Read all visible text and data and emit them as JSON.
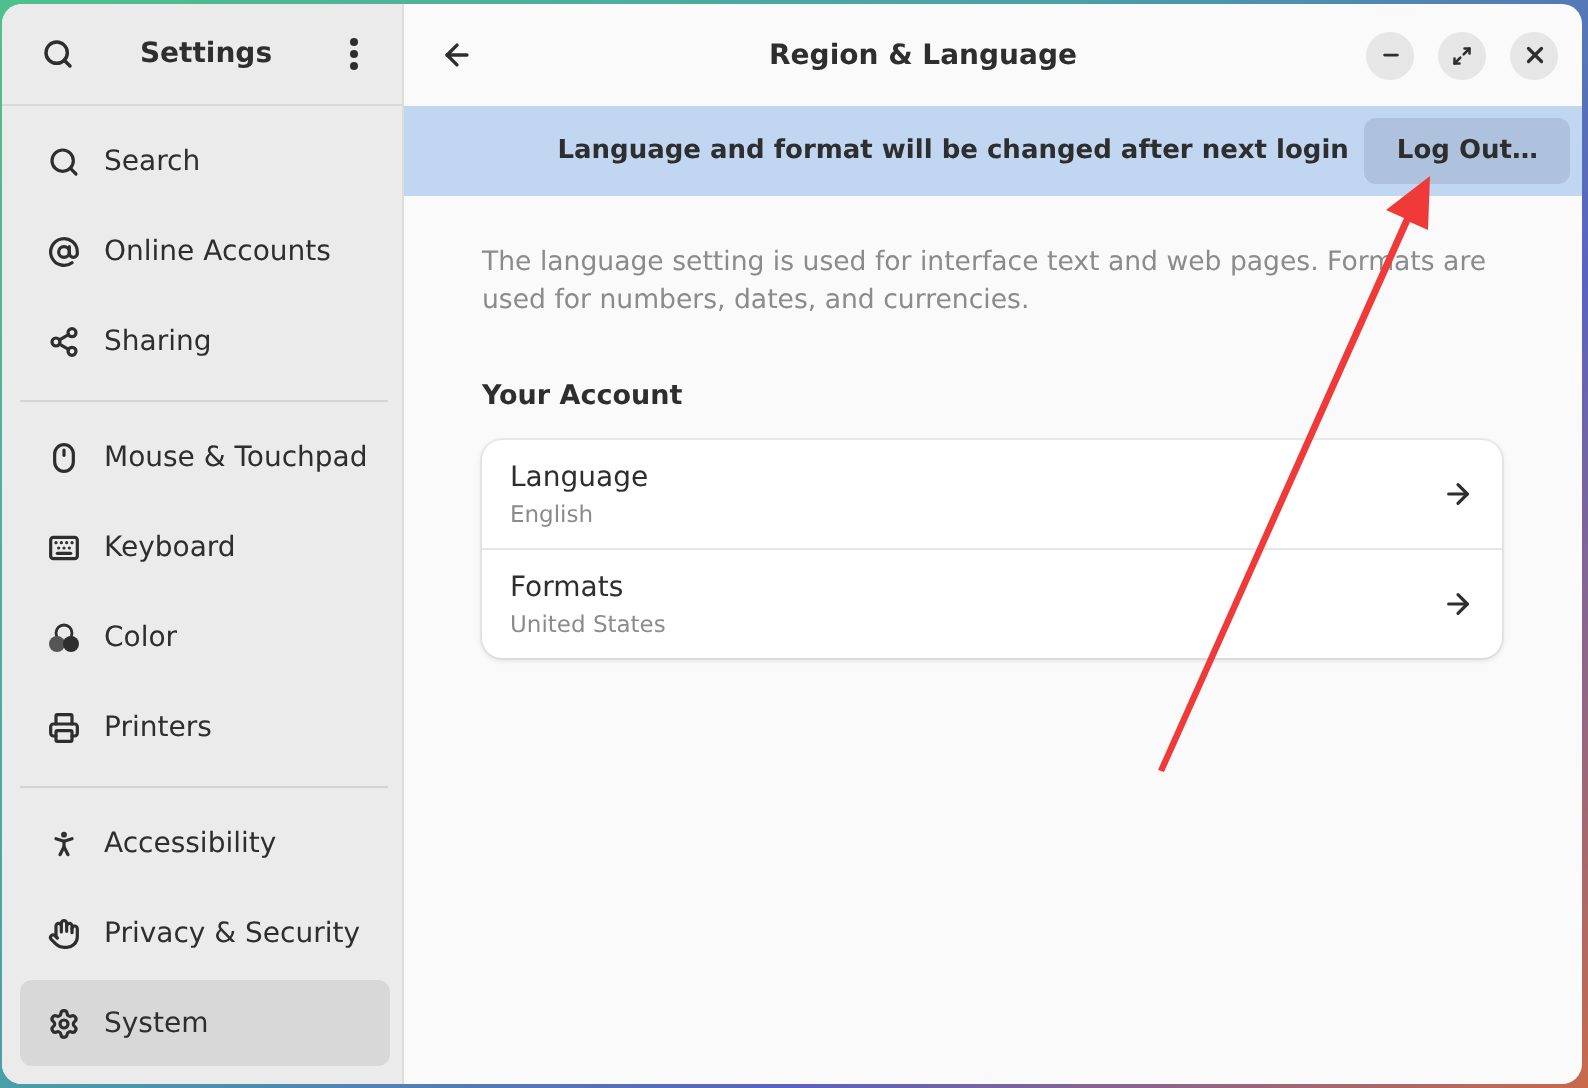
{
  "sidebar": {
    "title": "Settings",
    "groups": [
      {
        "items": [
          {
            "label": "Search",
            "selected": false
          },
          {
            "label": "Online Accounts",
            "selected": false
          },
          {
            "label": "Sharing",
            "selected": false
          }
        ]
      },
      {
        "items": [
          {
            "label": "Mouse & Touchpad",
            "selected": false
          },
          {
            "label": "Keyboard",
            "selected": false
          },
          {
            "label": "Color",
            "selected": false
          },
          {
            "label": "Printers",
            "selected": false
          }
        ]
      },
      {
        "items": [
          {
            "label": "Accessibility",
            "selected": false
          },
          {
            "label": "Privacy & Security",
            "selected": false
          },
          {
            "label": "System",
            "selected": true
          }
        ]
      }
    ]
  },
  "window": {
    "title": "Region & Language"
  },
  "banner": {
    "message": "Language and format will be changed after next login",
    "button": "Log Out…"
  },
  "description": "The language setting is used for interface text and web pages. Formats are used for numbers, dates, and currencies.",
  "section": {
    "title": "Your Account",
    "rows": [
      {
        "title": "Language",
        "value": "English"
      },
      {
        "title": "Formats",
        "value": "United States"
      }
    ]
  }
}
